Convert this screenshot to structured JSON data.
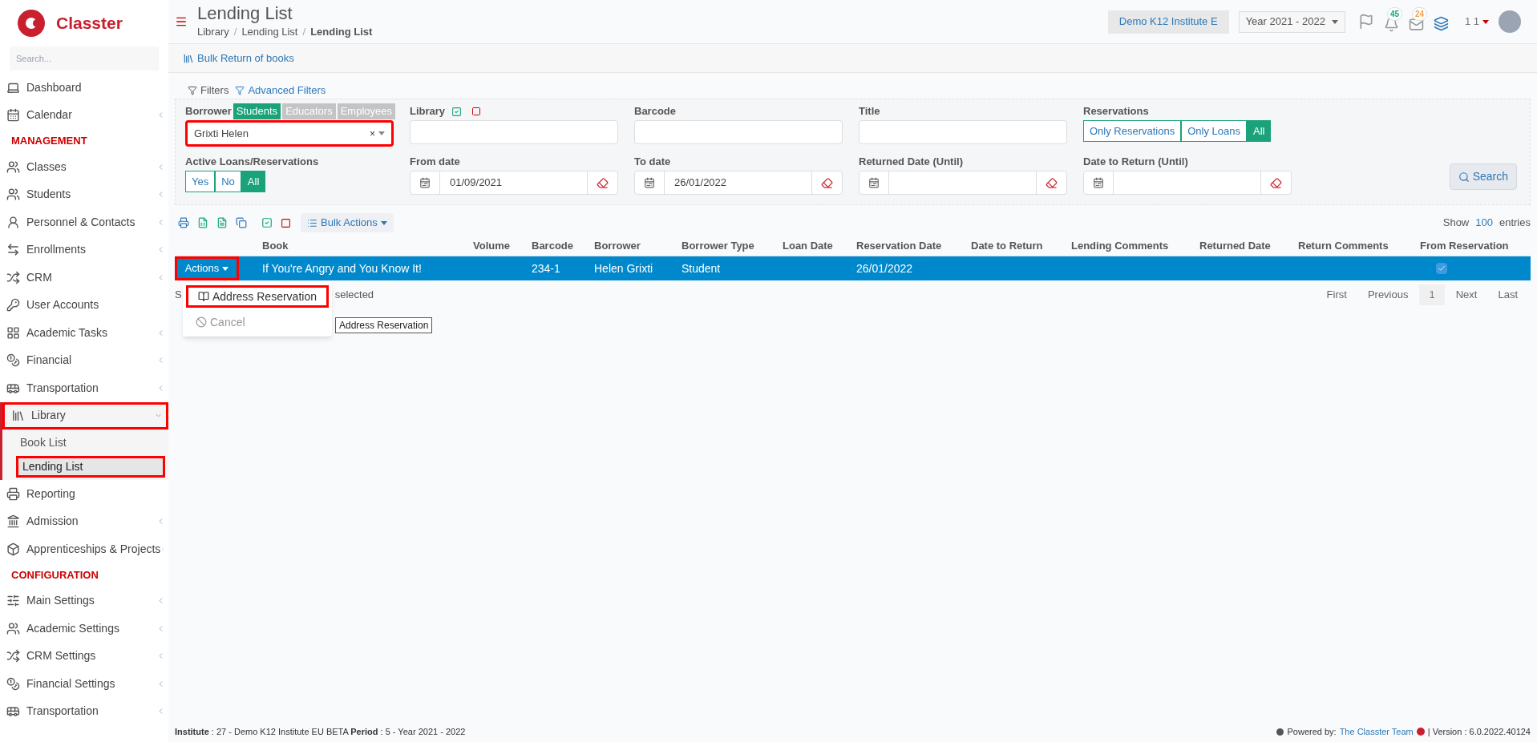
{
  "brand": {
    "name": "Classter"
  },
  "sidebar": {
    "search_placeholder": "Search...",
    "sections": [
      {
        "items": [
          {
            "label": "Dashboard",
            "expandable": false
          },
          {
            "label": "Calendar",
            "expandable": true
          }
        ]
      },
      {
        "heading": "MANAGEMENT",
        "items": [
          {
            "label": "Classes",
            "expandable": true
          },
          {
            "label": "Students",
            "expandable": true
          },
          {
            "label": "Personnel & Contacts",
            "expandable": true
          },
          {
            "label": "Enrollments",
            "expandable": true
          },
          {
            "label": "CRM",
            "expandable": true
          },
          {
            "label": "User Accounts",
            "expandable": false
          },
          {
            "label": "Academic Tasks",
            "expandable": true
          },
          {
            "label": "Financial",
            "expandable": true
          },
          {
            "label": "Transportation",
            "expandable": true
          },
          {
            "label": "Library",
            "expandable": true,
            "expanded": true,
            "highlighted": true,
            "children": [
              {
                "label": "Book List",
                "selected": false,
                "highlighted": false
              },
              {
                "label": "Lending List",
                "selected": true,
                "highlighted": true
              }
            ]
          },
          {
            "label": "Reporting",
            "expandable": false
          },
          {
            "label": "Admission",
            "expandable": true
          },
          {
            "label": "Apprenticeships & Projects",
            "expandable": true
          }
        ]
      },
      {
        "heading": "CONFIGURATION",
        "items": [
          {
            "label": "Main Settings",
            "expandable": true
          },
          {
            "label": "Academic Settings",
            "expandable": true
          },
          {
            "label": "CRM Settings",
            "expandable": true
          },
          {
            "label": "Financial Settings",
            "expandable": true
          },
          {
            "label": "Transportation",
            "expandable": true
          }
        ]
      }
    ]
  },
  "header": {
    "title": "Lending List",
    "breadcrumbs": [
      "Library",
      "Lending List",
      "Lending List"
    ],
    "separator": "/",
    "institute": "Demo K12 Institute E",
    "year": "Year 2021 - 2022",
    "notifications": [
      {
        "count": "45",
        "color": "#1aa37a"
      },
      {
        "count": "24",
        "color": "#f0a04b"
      }
    ],
    "user": "1 1"
  },
  "action_bar": {
    "bulk_return": "Bulk Return of books"
  },
  "filters": {
    "title": "Filters",
    "advanced": "Advanced Filters",
    "borrower": {
      "label": "Borrower",
      "types": [
        {
          "label": "Students",
          "selected": true
        },
        {
          "label": "Educators",
          "selected": false
        },
        {
          "label": "Employees",
          "selected": false
        }
      ],
      "value": "Grixti Helen",
      "clear": "×",
      "highlighted": true
    },
    "library": {
      "label": "Library"
    },
    "barcode": {
      "label": "Barcode"
    },
    "title_field": {
      "label": "Title"
    },
    "reservations": {
      "label": "Reservations",
      "options": [
        {
          "label": "Only Reservations",
          "selected": false
        },
        {
          "label": "Only Loans",
          "selected": false
        },
        {
          "label": "All",
          "selected": true
        }
      ]
    },
    "active": {
      "label": "Active Loans/Reservations",
      "options": [
        {
          "label": "Yes",
          "selected": false
        },
        {
          "label": "No",
          "selected": false
        },
        {
          "label": "All",
          "selected": true
        }
      ]
    },
    "dates": [
      {
        "label": "From date",
        "value": "01/09/2021"
      },
      {
        "label": "To date",
        "value": "26/01/2022"
      },
      {
        "label": "Returned Date (Until)"
      },
      {
        "label": "Date to Return (Until)"
      }
    ],
    "search": "Search"
  },
  "table": {
    "bulk_actions": "Bulk Actions",
    "show": "Show",
    "page_size": "100",
    "entries": "entries",
    "columns": [
      "",
      "Book",
      "Volume",
      "Barcode",
      "Borrower",
      "Borrower Type",
      "Loan Date",
      "Reservation Date",
      "Date to Return",
      "Lending Comments",
      "Returned Date",
      "Return Comments",
      "From Reservation"
    ],
    "rows": [
      {
        "selected": true,
        "actions_highlighted": true,
        "cells": [
          "Actions",
          "If You're Angry and You Know It!",
          "",
          "234-1",
          "Helen Grixti",
          "Student",
          "",
          "26/01/2022",
          "",
          "",
          "",
          "",
          ""
        ],
        "from_reservation": true
      }
    ],
    "info_parts": [
      "S",
      "selected"
    ],
    "pagination": [
      {
        "label": "First",
        "selected": false
      },
      {
        "label": "Previous",
        "selected": false
      },
      {
        "label": "1",
        "selected": true
      },
      {
        "label": "Next",
        "selected": false
      },
      {
        "label": "Last",
        "selected": false
      }
    ]
  },
  "actions_menu": {
    "items": [
      {
        "label": "Address Reservation",
        "highlighted": true,
        "disabled": false
      },
      {
        "label": "Cancel",
        "highlighted": false,
        "disabled": true
      }
    ],
    "tooltip": "Address Reservation"
  },
  "footer": {
    "left": "**Institute** : 27 - Demo K12 Institute EU BETA **Period** : 5 - Year 2021 - 2022",
    "powered": "Powered by:",
    "team": "The Classter Team",
    "version": "| Version : 6.0.2022.40124"
  }
}
